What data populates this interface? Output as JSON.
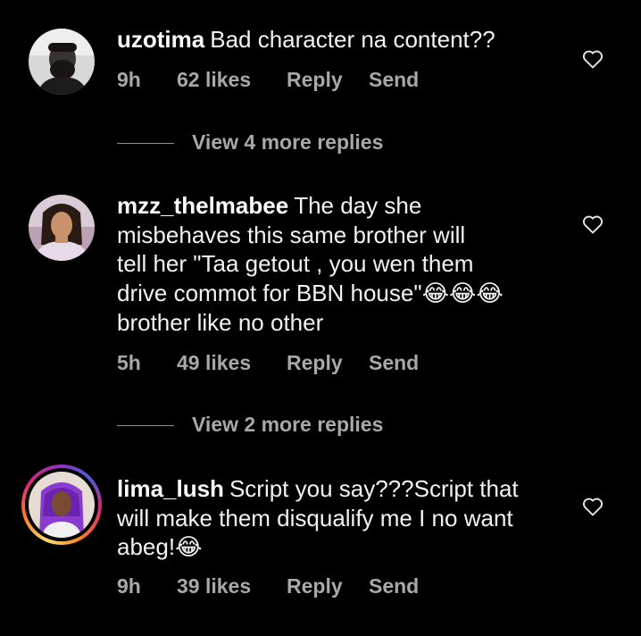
{
  "comments": [
    {
      "username": "uzotima",
      "text": "Bad character na content??",
      "time": "9h",
      "likes": "62 likes",
      "reply": "Reply",
      "send": "Send"
    },
    {
      "username": "mzz_thelmabee",
      "text_lines": [
        "The day she",
        "misbehaves  this same brother will",
        "tell her \"Taa getout , you wen them",
        "drive commot for BBN house\"",
        "brother like no other"
      ],
      "emoji_line4": "😂😂😂",
      "time": "5h",
      "likes": "49 likes",
      "reply": "Reply",
      "send": "Send"
    },
    {
      "username": "lima_lush",
      "text_lines": [
        "Script you say???Script that",
        "will make them disqualify me I no want",
        "abeg!"
      ],
      "emoji_line3": "😂",
      "time": "9h",
      "likes": "39 likes",
      "reply": "Reply",
      "send": "Send"
    }
  ],
  "view_more": [
    {
      "label": "View 4 more replies"
    },
    {
      "label": "View 2 more replies"
    }
  ],
  "colors": {
    "background": "#000000",
    "primary_text": "#f2f2f2",
    "secondary_text": "#a8a8a8",
    "story_ring": [
      "#feda75",
      "#fa7e1e",
      "#d62976",
      "#962fbf",
      "#4f5bd5"
    ]
  },
  "icons": {
    "like": "heart-outline-icon"
  }
}
